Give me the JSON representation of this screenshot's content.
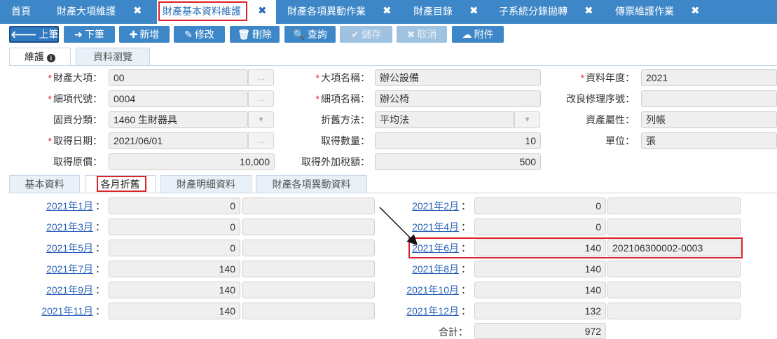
{
  "top_tabs": [
    {
      "label": "首頁",
      "closable": false
    },
    {
      "label": "財產大項維護",
      "closable": true
    },
    {
      "label": "財產基本資料維護",
      "closable": true
    },
    {
      "label": "財產各項異動作業",
      "closable": true
    },
    {
      "label": "財產目錄",
      "closable": true
    },
    {
      "label": "子系統分錄拋轉",
      "closable": true
    },
    {
      "label": "傳票維護作業",
      "closable": true
    }
  ],
  "toolbar": {
    "prev": "上筆",
    "next": "下筆",
    "add": "新增",
    "edit": "修改",
    "delete": "刪除",
    "query": "查詢",
    "save": "儲存",
    "cancel": "取消",
    "attach": "附件"
  },
  "view_tabs": {
    "maintain": "維護",
    "browse": "資料瀏覽"
  },
  "form": {
    "category_label": "財產大項：",
    "category_value": "00",
    "category_name_label": "大項名稱：",
    "category_name_value": "辦公設備",
    "year_label": "資料年度：",
    "year_value": "2021",
    "item_code_label": "細項代號：",
    "item_code_value": "0004",
    "item_name_label": "細項名稱：",
    "item_name_value": "辦公椅",
    "improve_seq_label": "改良修理序號：",
    "improve_seq_value": "",
    "asset_class_label": "固資分類：",
    "asset_class_value": "1460 生財器具",
    "dep_method_label": "折舊方法：",
    "dep_method_value": "平均法",
    "asset_attr_label": "資產屬性：",
    "asset_attr_value": "列帳",
    "acq_date_label": "取得日期：",
    "acq_date_value": "2021/06/01",
    "acq_qty_label": "取得數量：",
    "acq_qty_value": "10",
    "unit_label": "單位：",
    "unit_value": "張",
    "acq_cost_label": "取得原價：",
    "acq_cost_value": "10,000",
    "acq_tax_label": "取得外加稅額：",
    "acq_tax_value": "500"
  },
  "detail_tabs": {
    "basic": "基本資料",
    "monthly": "各月折舊",
    "detail": "財產明細資料",
    "changes": "財產各項異動資料"
  },
  "months": [
    {
      "label": "2021年1月",
      "amount": "0",
      "voucher": ""
    },
    {
      "label": "2021年2月",
      "amount": "0",
      "voucher": ""
    },
    {
      "label": "2021年3月",
      "amount": "0",
      "voucher": ""
    },
    {
      "label": "2021年4月",
      "amount": "0",
      "voucher": ""
    },
    {
      "label": "2021年5月",
      "amount": "0",
      "voucher": ""
    },
    {
      "label": "2021年6月",
      "amount": "140",
      "voucher": "202106300002-0003"
    },
    {
      "label": "2021年7月",
      "amount": "140",
      "voucher": ""
    },
    {
      "label": "2021年8月",
      "amount": "140",
      "voucher": ""
    },
    {
      "label": "2021年9月",
      "amount": "140",
      "voucher": ""
    },
    {
      "label": "2021年10月",
      "amount": "140",
      "voucher": ""
    },
    {
      "label": "2021年11月",
      "amount": "140",
      "voucher": ""
    },
    {
      "label": "2021年12月",
      "amount": "132",
      "voucher": ""
    }
  ],
  "total": {
    "label": "合計：",
    "value": "972"
  },
  "colon": "：",
  "ellipsis": "...",
  "accent_color": "#3d87c8",
  "highlight_color": "#d8232a"
}
